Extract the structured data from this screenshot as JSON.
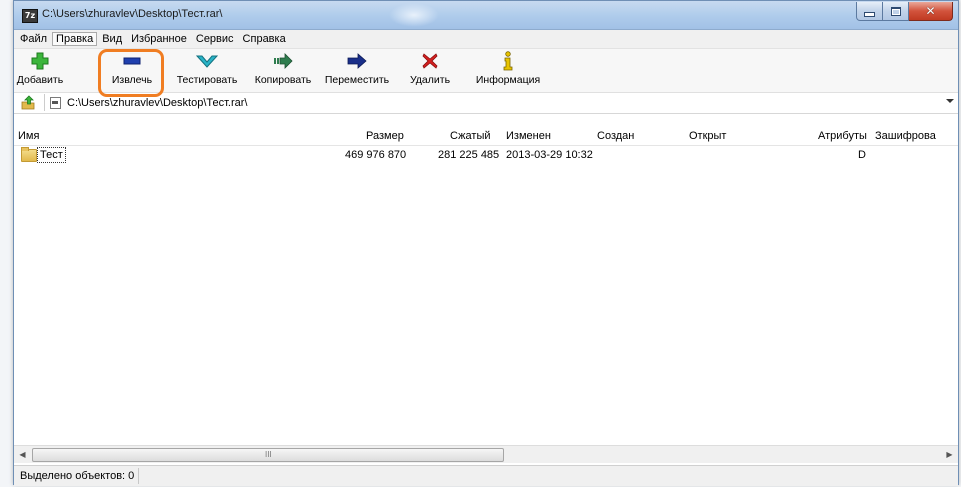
{
  "window": {
    "title": "C:\\Users\\zhuravlev\\Desktop\\Тест.rar\\",
    "icon_text": "7z"
  },
  "menu": {
    "items": [
      "Файл",
      "Правка",
      "Вид",
      "Избранное",
      "Сервис",
      "Справка"
    ],
    "active_index": 1
  },
  "toolbar": {
    "add": "Добавить",
    "extract": "Извлечь",
    "test": "Тестировать",
    "copy": "Копировать",
    "move": "Переместить",
    "delete": "Удалить",
    "info": "Информация"
  },
  "address": {
    "path": "C:\\Users\\zhuravlev\\Desktop\\Тест.rar\\"
  },
  "columns": {
    "name": "Имя",
    "size": "Размер",
    "packed": "Сжатый",
    "modified": "Изменен",
    "created": "Создан",
    "accessed": "Открыт",
    "attributes": "Атрибуты",
    "encrypted": "Зашифрова"
  },
  "rows": [
    {
      "name": "Тест",
      "size": "469 976 870",
      "packed": "281 225 485",
      "modified": "2013-03-29 10:32",
      "created": "",
      "accessed": "",
      "attributes": "D"
    }
  ],
  "scrollbar": {
    "grip": "III"
  },
  "status": {
    "text": "Выделено объектов: 0"
  },
  "colors": {
    "highlight": "#f07d22",
    "add_icon": "#3bb53b",
    "extract_icon": "#1f3fae",
    "test_icon": "#29b3c7",
    "copy_icon": "#2f7d4f",
    "move_icon": "#1a2f8a",
    "delete_icon": "#d42020",
    "info_icon": "#c9a100"
  }
}
